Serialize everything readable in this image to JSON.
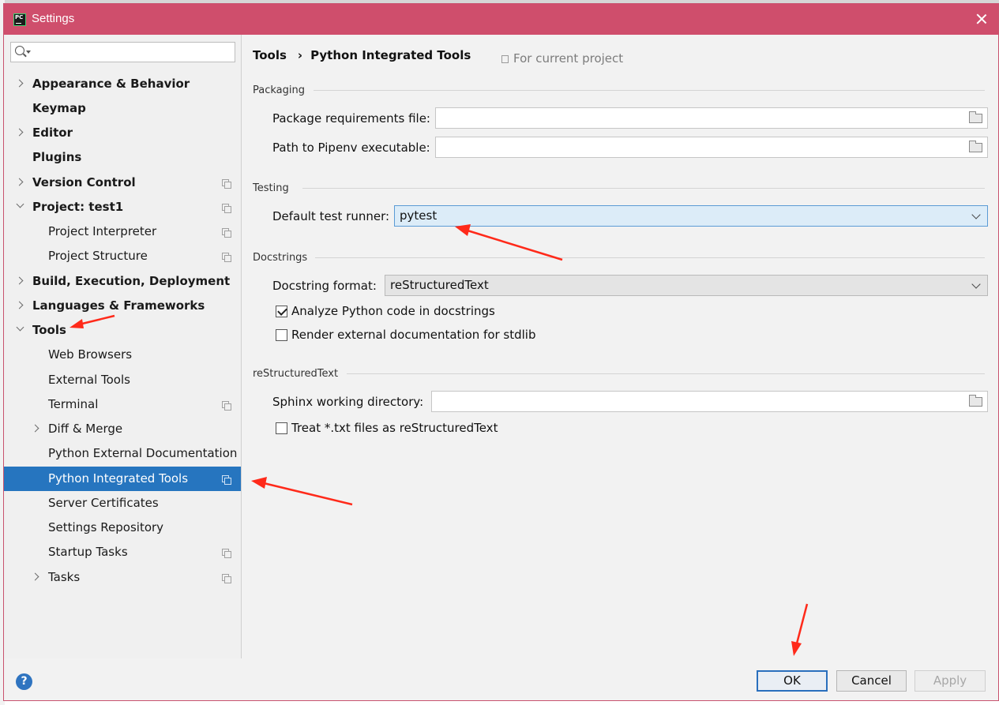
{
  "window": {
    "title": "Settings",
    "app_icon_text": "PC"
  },
  "sidebar": {
    "search": {
      "value": "",
      "placeholder": ""
    },
    "items": [
      {
        "label": "Appearance & Behavior"
      },
      {
        "label": "Keymap"
      },
      {
        "label": "Editor"
      },
      {
        "label": "Plugins"
      },
      {
        "label": "Version Control"
      },
      {
        "label": "Project: test1"
      },
      {
        "label": "Project Interpreter"
      },
      {
        "label": "Project Structure"
      },
      {
        "label": "Build, Execution, Deployment"
      },
      {
        "label": "Languages & Frameworks"
      },
      {
        "label": "Tools"
      },
      {
        "label": "Web Browsers"
      },
      {
        "label": "External Tools"
      },
      {
        "label": "Terminal"
      },
      {
        "label": "Diff & Merge"
      },
      {
        "label": "Python External Documentation"
      },
      {
        "label": "Python Integrated Tools"
      },
      {
        "label": "Server Certificates"
      },
      {
        "label": "Settings Repository"
      },
      {
        "label": "Startup Tasks"
      },
      {
        "label": "Tasks"
      }
    ]
  },
  "main": {
    "breadcrumb": {
      "parent": "Tools",
      "separator": "›",
      "current": "Python Integrated Tools"
    },
    "scope_hint": "For current project",
    "packaging": {
      "title": "Packaging",
      "requirements_label": "Package requirements file:",
      "requirements_value": "",
      "pipenv_label": "Path to Pipenv executable:",
      "pipenv_value": ""
    },
    "testing": {
      "title": "Testing",
      "runner_label": "Default test runner:",
      "runner_value": "pytest"
    },
    "docstrings": {
      "title": "Docstrings",
      "format_label": "Docstring format:",
      "format_value": "reStructuredText",
      "analyze_label": "Analyze Python code in docstrings",
      "analyze_checked": true,
      "render_label": "Render external documentation for stdlib",
      "render_checked": false
    },
    "restructured": {
      "title": "reStructuredText",
      "sphinx_label": "Sphinx working directory:",
      "sphinx_value": "",
      "treat_label": "Treat *.txt files as reStructuredText",
      "treat_checked": false
    }
  },
  "footer": {
    "help_icon": "?",
    "ok_label": "OK",
    "cancel_label": "Cancel",
    "apply_label": "Apply"
  },
  "colors": {
    "titlebar": "#cf4e6c",
    "selection": "#2675bf",
    "annotation_arrow": "#ff2a1a"
  }
}
